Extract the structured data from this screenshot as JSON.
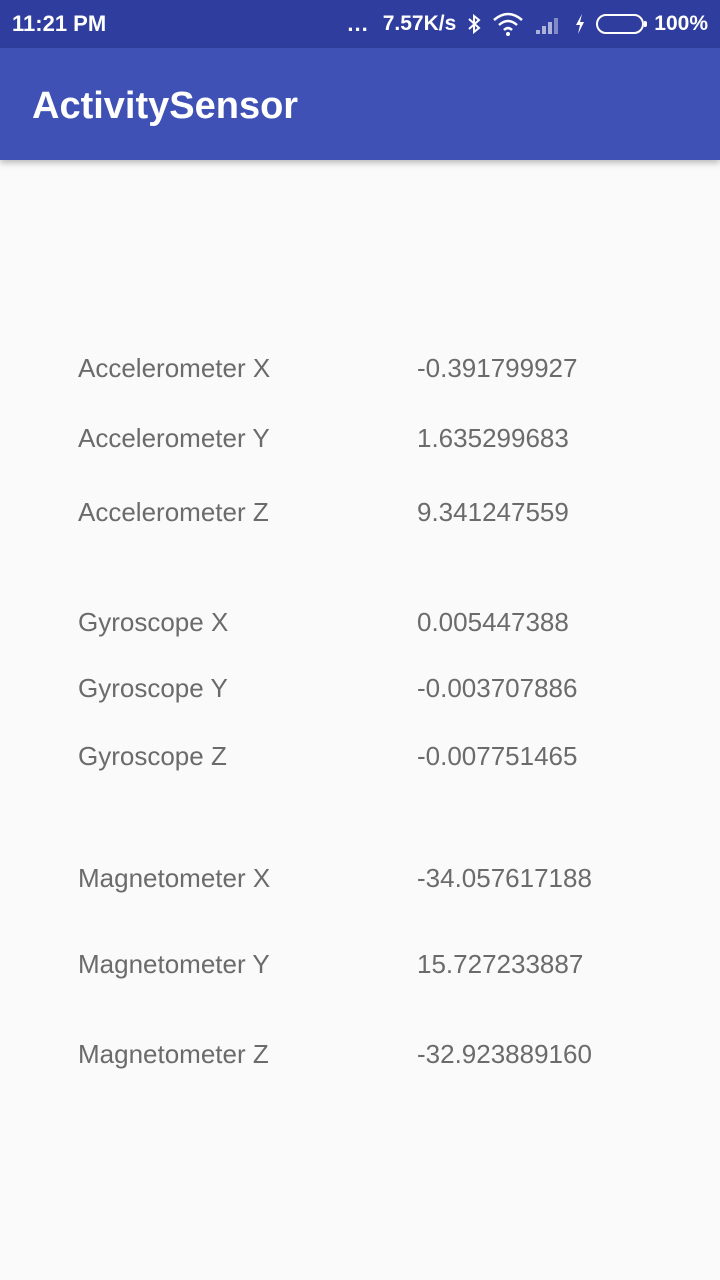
{
  "status_bar": {
    "time": "11:21 PM",
    "dots": "...",
    "network_speed": "7.57K/s",
    "battery_percent": "100%",
    "battery_level": 1.0,
    "battery_color": "#3bd13b",
    "icons": [
      "bluetooth-icon",
      "wifi-icon",
      "signal-icon",
      "charging-icon",
      "battery-icon"
    ]
  },
  "app_bar": {
    "title": "ActivitySensor",
    "color": "#3f51b5"
  },
  "sensors": [
    {
      "label": "Accelerometer X",
      "value": "-0.391799927"
    },
    {
      "label": "Accelerometer Y",
      "value": "1.635299683"
    },
    {
      "label": "Accelerometer Z",
      "value": "9.341247559"
    },
    {
      "label": "Gyroscope X",
      "value": "0.005447388"
    },
    {
      "label": "Gyroscope Y",
      "value": "-0.003707886"
    },
    {
      "label": "Gyroscope Z",
      "value": "-0.007751465"
    },
    {
      "label": "Magnetometer X",
      "value": "-34.057617188"
    },
    {
      "label": "Magnetometer Y",
      "value": "15.727233887"
    },
    {
      "label": "Magnetometer Z",
      "value": "-32.923889160"
    }
  ]
}
